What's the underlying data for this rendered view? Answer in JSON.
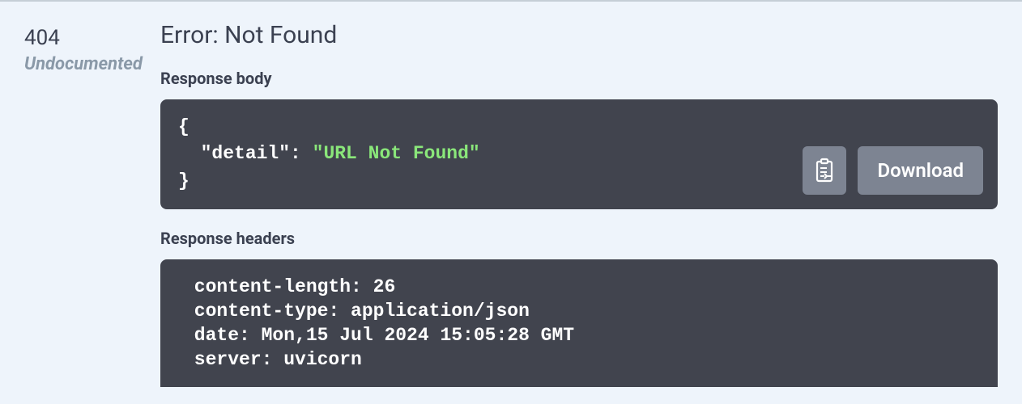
{
  "status_code": "404",
  "undocumented_label": "Undocumented",
  "error_title": "Error: Not Found",
  "response_body_label": "Response body",
  "response_body": {
    "key": "\"detail\"",
    "value": "\"URL Not Found\""
  },
  "download_label": "Download",
  "response_headers_label": "Response headers",
  "response_headers": " content-length: 26 \n content-type: application/json \n date: Mon,15 Jul 2024 15:05:28 GMT \n server: uvicorn "
}
